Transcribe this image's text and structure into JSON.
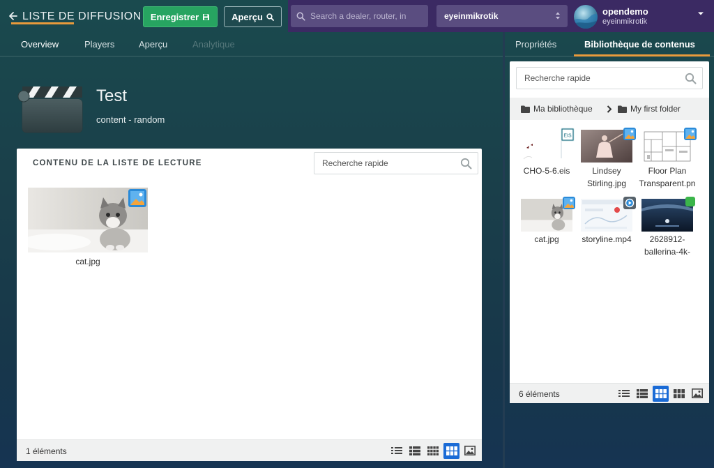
{
  "header": {
    "title": "LISTE DE DIFFUSION",
    "save_label": "Enregistrer",
    "preview_label": "Aperçu",
    "search_placeholder": "Search a dealer, router, in",
    "org_selected": "eyeinmikrotik",
    "user_name": "opendemo",
    "user_org": "eyeinmikrotik"
  },
  "tabs": [
    {
      "label": "Overview",
      "active": true
    },
    {
      "label": "Players",
      "active": false
    },
    {
      "label": "Aperçu",
      "active": false
    },
    {
      "label": "Analytique",
      "active": false,
      "disabled": true
    }
  ],
  "right_tabs": [
    {
      "label": "Propriétés",
      "active": false
    },
    {
      "label": "Bibliothèque de contenus",
      "active": true
    }
  ],
  "playlist": {
    "name": "Test",
    "subtitle": "content - random",
    "section_heading": "CONTENU DE LA LISTE DE LECTURE",
    "search_placeholder": "Recherche rapide",
    "items": [
      {
        "caption": "cat.jpg",
        "kind": "image"
      }
    ],
    "count_label": "1 éléments"
  },
  "library": {
    "search_placeholder": "Recherche rapide",
    "breadcrumb": [
      "Ma bibliothèque",
      "My first folder"
    ],
    "items": [
      {
        "caption_lines": [
          "CHO-5-6.eis"
        ],
        "kind": "eis"
      },
      {
        "caption_lines": [
          "Lindsey",
          "Stirling.jpg"
        ],
        "kind": "image"
      },
      {
        "caption_lines": [
          "Floor Plan",
          "Transparent.pn"
        ],
        "kind": "image"
      },
      {
        "caption_lines": [
          "cat.jpg"
        ],
        "kind": "image"
      },
      {
        "caption_lines": [
          "storyline.mp4"
        ],
        "kind": "video"
      },
      {
        "caption_lines": [
          "2628912-",
          "ballerina-4k-"
        ],
        "kind": "image"
      }
    ],
    "count_label": "6 éléments"
  },
  "colors": {
    "accent_orange": "#e89a3c",
    "save_green": "#27a461",
    "topbar_purple": "#3b2a63",
    "selected_view_blue": "#1a6bd6"
  },
  "icons": [
    "back-arrow-icon",
    "floppy-icon",
    "search-icon",
    "select-caret-icon",
    "user-caret-icon",
    "clapperboard-icon",
    "image-badge-icon",
    "video-badge-icon",
    "folder-icon",
    "chevron-right-icon",
    "list-view-icon",
    "detail-list-icon",
    "small-grid-icon",
    "medium-grid-icon",
    "large-image-icon"
  ]
}
